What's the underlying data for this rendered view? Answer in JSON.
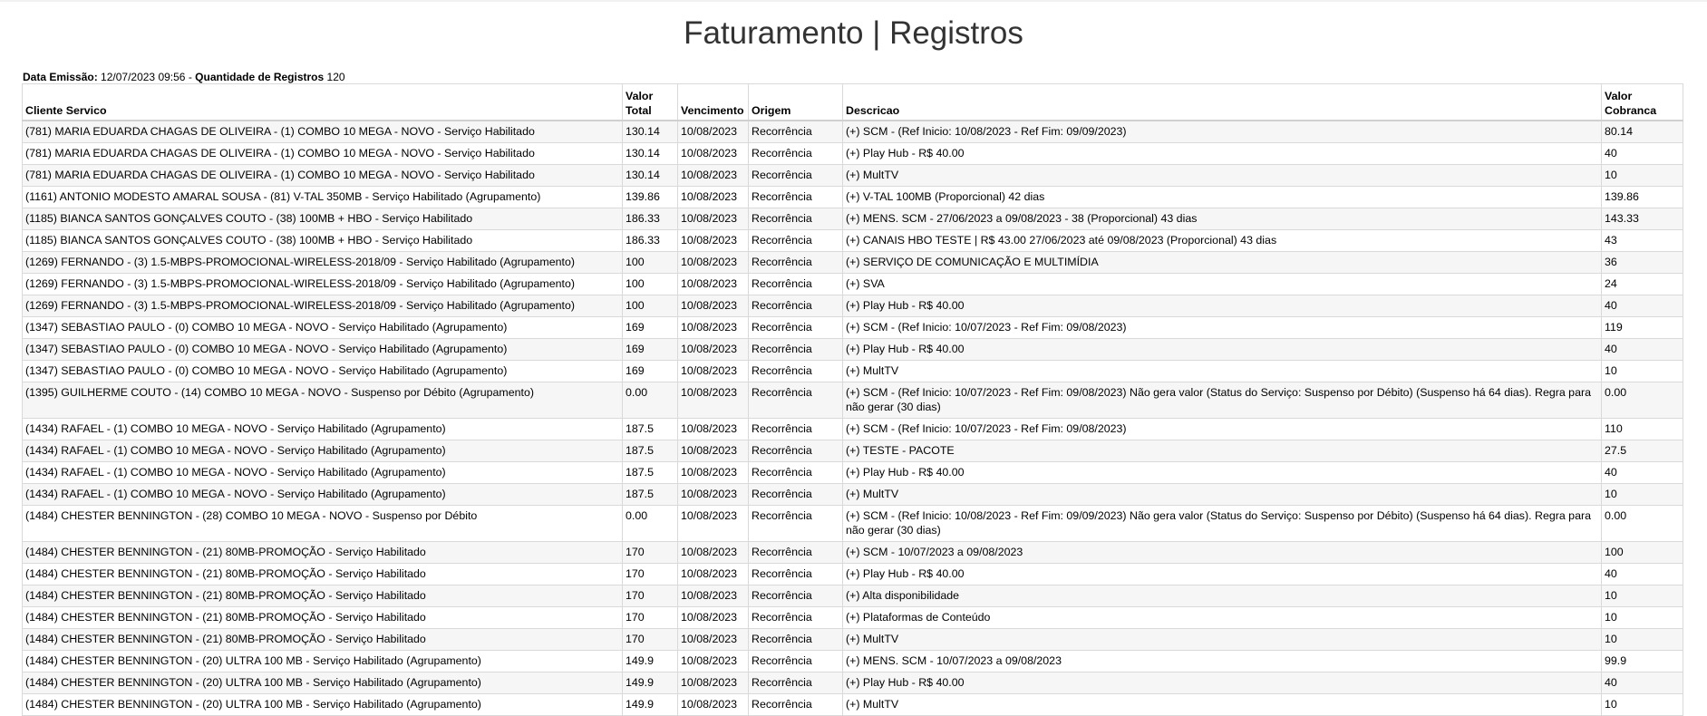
{
  "header": {
    "title": "Faturamento | Registros"
  },
  "meta": {
    "emissao_label": "Data Emissão:",
    "emissao_value": "12/07/2023 09:56",
    "separator": "-",
    "qtd_label": "Quantidade de Registros",
    "qtd_value": "120"
  },
  "table": {
    "columns": [
      "Cliente Servico",
      "Valor Total",
      "Vencimento",
      "Origem",
      "Descricao",
      "Valor Cobranca"
    ],
    "rows": [
      [
        "(781) MARIA EDUARDA CHAGAS DE OLIVEIRA - (1) COMBO 10 MEGA - NOVO - Serviço Habilitado",
        "130.14",
        "10/08/2023",
        "Recorrência",
        "(+) SCM - (Ref Inicio: 10/08/2023 - Ref Fim: 09/09/2023)",
        "80.14"
      ],
      [
        "(781) MARIA EDUARDA CHAGAS DE OLIVEIRA - (1) COMBO 10 MEGA - NOVO - Serviço Habilitado",
        "130.14",
        "10/08/2023",
        "Recorrência",
        "(+) Play Hub - R$ 40.00",
        "40"
      ],
      [
        "(781) MARIA EDUARDA CHAGAS DE OLIVEIRA - (1) COMBO 10 MEGA - NOVO - Serviço Habilitado",
        "130.14",
        "10/08/2023",
        "Recorrência",
        "(+) MultTV",
        "10"
      ],
      [
        "(1161) ANTONIO MODESTO AMARAL SOUSA - (81) V-TAL 350MB - Serviço Habilitado (Agrupamento)",
        "139.86",
        "10/08/2023",
        "Recorrência",
        "(+) V-TAL 100MB (Proporcional) 42 dias",
        "139.86"
      ],
      [
        "(1185) BIANCA SANTOS GONÇALVES COUTO - (38) 100MB + HBO - Serviço Habilitado",
        "186.33",
        "10/08/2023",
        "Recorrência",
        "(+) MENS. SCM - 27/06/2023 a 09/08/2023 - 38 (Proporcional) 43 dias",
        "143.33"
      ],
      [
        "(1185) BIANCA SANTOS GONÇALVES COUTO - (38) 100MB + HBO - Serviço Habilitado",
        "186.33",
        "10/08/2023",
        "Recorrência",
        "(+) CANAIS HBO TESTE | R$ 43.00 27/06/2023 até 09/08/2023 (Proporcional) 43 dias",
        "43"
      ],
      [
        "(1269) FERNANDO - (3) 1.5-MBPS-PROMOCIONAL-WIRELESS-2018/09 - Serviço Habilitado (Agrupamento)",
        "100",
        "10/08/2023",
        "Recorrência",
        "(+) SERVIÇO DE COMUNICAÇÃO E MULTIMÍDIA",
        "36"
      ],
      [
        "(1269) FERNANDO - (3) 1.5-MBPS-PROMOCIONAL-WIRELESS-2018/09 - Serviço Habilitado (Agrupamento)",
        "100",
        "10/08/2023",
        "Recorrência",
        "(+) SVA",
        "24"
      ],
      [
        "(1269) FERNANDO - (3) 1.5-MBPS-PROMOCIONAL-WIRELESS-2018/09 - Serviço Habilitado (Agrupamento)",
        "100",
        "10/08/2023",
        "Recorrência",
        "(+) Play Hub - R$ 40.00",
        "40"
      ],
      [
        "(1347) SEBASTIAO PAULO - (0) COMBO 10 MEGA - NOVO - Serviço Habilitado (Agrupamento)",
        "169",
        "10/08/2023",
        "Recorrência",
        "(+) SCM - (Ref Inicio: 10/07/2023 - Ref Fim: 09/08/2023)",
        "119"
      ],
      [
        "(1347) SEBASTIAO PAULO - (0) COMBO 10 MEGA - NOVO - Serviço Habilitado (Agrupamento)",
        "169",
        "10/08/2023",
        "Recorrência",
        "(+) Play Hub - R$ 40.00",
        "40"
      ],
      [
        "(1347) SEBASTIAO PAULO - (0) COMBO 10 MEGA - NOVO - Serviço Habilitado (Agrupamento)",
        "169",
        "10/08/2023",
        "Recorrência",
        "(+) MultTV",
        "10"
      ],
      [
        "(1395) GUILHERME COUTO - (14) COMBO 10 MEGA - NOVO - Suspenso por Débito (Agrupamento)",
        "0.00",
        "10/08/2023",
        "Recorrência",
        "(+) SCM - (Ref Inicio: 10/07/2023 - Ref Fim: 09/08/2023) Não gera valor (Status do Serviço: Suspenso por Débito) (Suspenso há 64 dias). Regra para não gerar (30 dias)",
        "0.00"
      ],
      [
        "(1434) RAFAEL - (1) COMBO 10 MEGA - NOVO - Serviço Habilitado (Agrupamento)",
        "187.5",
        "10/08/2023",
        "Recorrência",
        "(+) SCM - (Ref Inicio: 10/07/2023 - Ref Fim: 09/08/2023)",
        "110"
      ],
      [
        "(1434) RAFAEL - (1) COMBO 10 MEGA - NOVO - Serviço Habilitado (Agrupamento)",
        "187.5",
        "10/08/2023",
        "Recorrência",
        "(+) TESTE - PACOTE",
        "27.5"
      ],
      [
        "(1434) RAFAEL - (1) COMBO 10 MEGA - NOVO - Serviço Habilitado (Agrupamento)",
        "187.5",
        "10/08/2023",
        "Recorrência",
        "(+) Play Hub - R$ 40.00",
        "40"
      ],
      [
        "(1434) RAFAEL - (1) COMBO 10 MEGA - NOVO - Serviço Habilitado (Agrupamento)",
        "187.5",
        "10/08/2023",
        "Recorrência",
        "(+) MultTV",
        "10"
      ],
      [
        "(1484) CHESTER BENNINGTON - (28) COMBO 10 MEGA - NOVO - Suspenso por Débito",
        "0.00",
        "10/08/2023",
        "Recorrência",
        "(+) SCM - (Ref Inicio: 10/08/2023 - Ref Fim: 09/09/2023) Não gera valor (Status do Serviço: Suspenso por Débito) (Suspenso há 64 dias). Regra para não gerar (30 dias)",
        "0.00"
      ],
      [
        "(1484) CHESTER BENNINGTON - (21) 80MB-PROMOÇÃO - Serviço Habilitado",
        "170",
        "10/08/2023",
        "Recorrência",
        "(+) SCM - 10/07/2023 a 09/08/2023",
        "100"
      ],
      [
        "(1484) CHESTER BENNINGTON - (21) 80MB-PROMOÇÃO - Serviço Habilitado",
        "170",
        "10/08/2023",
        "Recorrência",
        "(+) Play Hub - R$ 40.00",
        "40"
      ],
      [
        "(1484) CHESTER BENNINGTON - (21) 80MB-PROMOÇÃO - Serviço Habilitado",
        "170",
        "10/08/2023",
        "Recorrência",
        "(+) Alta disponibilidade",
        "10"
      ],
      [
        "(1484) CHESTER BENNINGTON - (21) 80MB-PROMOÇÃO - Serviço Habilitado",
        "170",
        "10/08/2023",
        "Recorrência",
        "(+) Plataformas de Conteúdo",
        "10"
      ],
      [
        "(1484) CHESTER BENNINGTON - (21) 80MB-PROMOÇÃO - Serviço Habilitado",
        "170",
        "10/08/2023",
        "Recorrência",
        "(+) MultTV",
        "10"
      ],
      [
        "(1484) CHESTER BENNINGTON - (20) ULTRA 100 MB - Serviço Habilitado (Agrupamento)",
        "149.9",
        "10/08/2023",
        "Recorrência",
        "(+) MENS. SCM - 10/07/2023 a 09/08/2023",
        "99.9"
      ],
      [
        "(1484) CHESTER BENNINGTON - (20) ULTRA 100 MB - Serviço Habilitado (Agrupamento)",
        "149.9",
        "10/08/2023",
        "Recorrência",
        "(+) Play Hub - R$ 40.00",
        "40"
      ],
      [
        "(1484) CHESTER BENNINGTON - (20) ULTRA 100 MB - Serviço Habilitado (Agrupamento)",
        "149.9",
        "10/08/2023",
        "Recorrência",
        "(+) MultTV",
        "10"
      ]
    ]
  }
}
